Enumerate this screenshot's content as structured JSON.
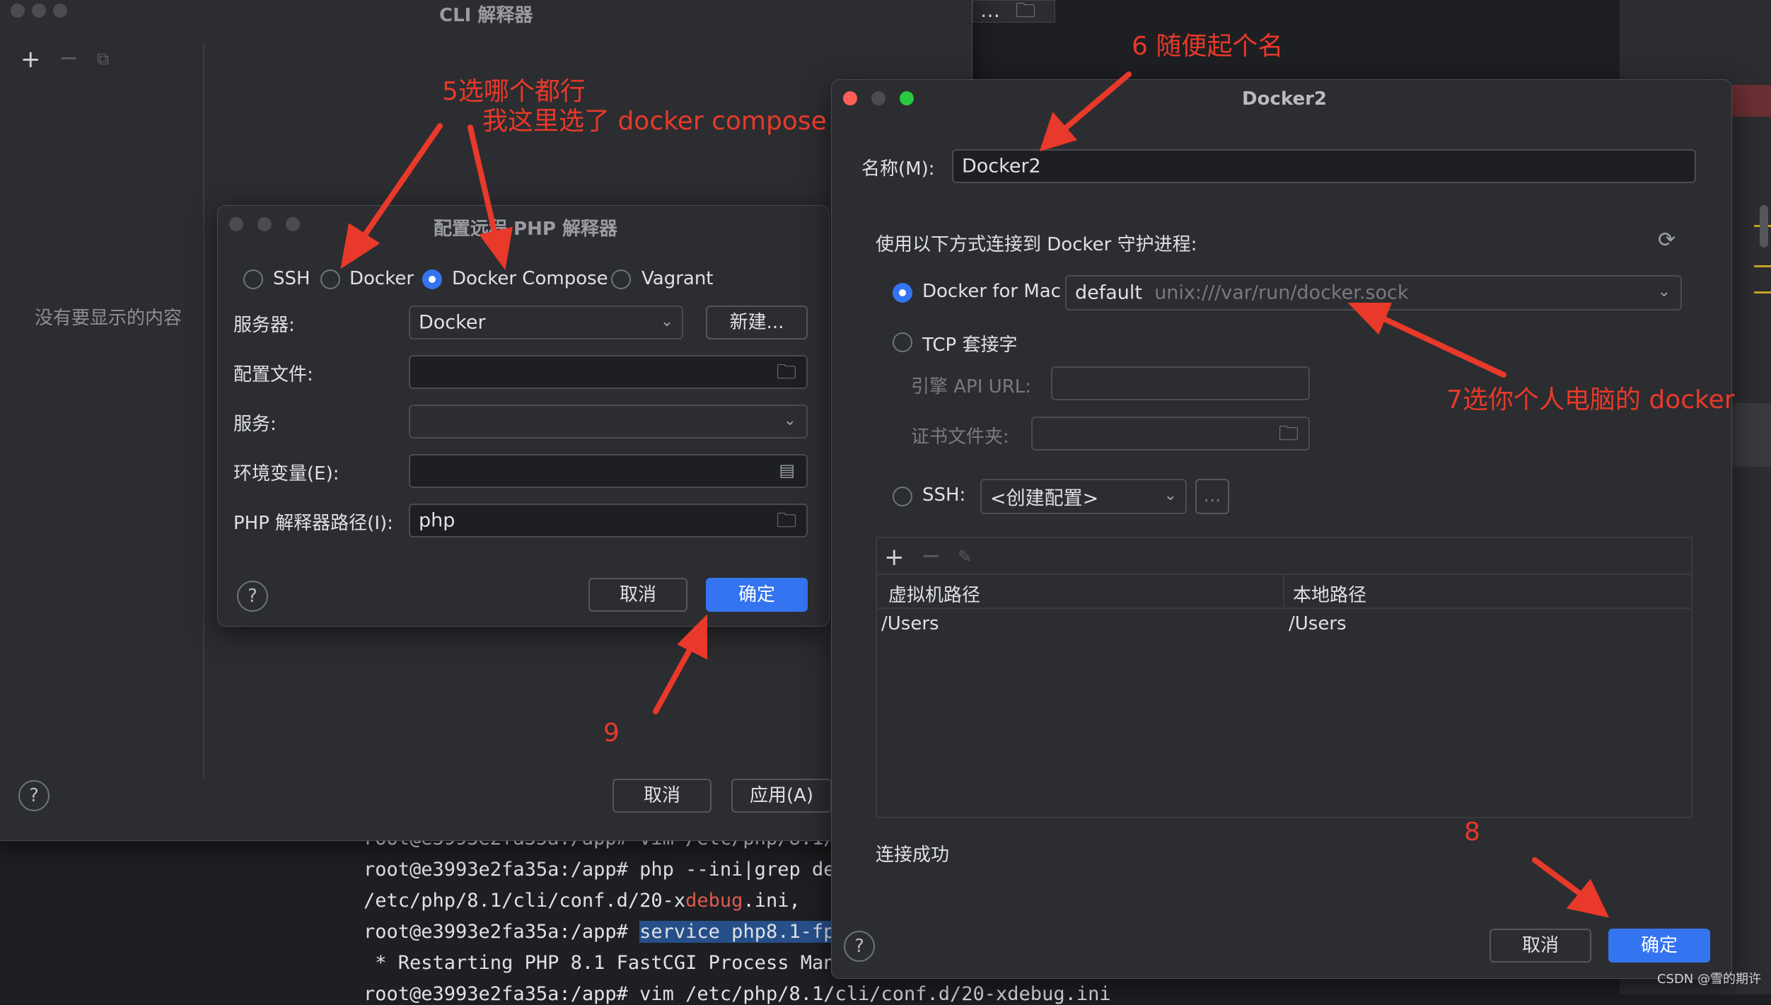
{
  "cli_window": {
    "title": "CLI 解释器",
    "empty_text": "没有要显示的内容",
    "cancel": "取消",
    "apply": "应用(A)",
    "help": "?"
  },
  "php_dialog": {
    "title": "配置远程 PHP 解释器",
    "connection_options": [
      "SSH",
      "Docker",
      "Docker Compose",
      "Vagrant"
    ],
    "selected_option": "Docker Compose",
    "server_label": "服务器:",
    "server_value": "Docker",
    "new_button": "新建...",
    "config_file_label": "配置文件:",
    "service_label": "服务:",
    "env_label": "环境变量(E):",
    "php_path_label": "PHP 解释器路径(I):",
    "php_path_value": "php",
    "cancel": "取消",
    "ok": "确定",
    "help": "?"
  },
  "docker_dialog": {
    "title": "Docker2",
    "name_label": "名称(M):",
    "name_value": "Docker2",
    "connect_heading": "使用以下方式连接到 Docker 守护进程:",
    "docker_for_mac_label": "Docker for Mac",
    "docker_for_mac_value": "default",
    "docker_for_mac_socket": "unix:///var/run/docker.sock",
    "tcp_label": "TCP 套接字",
    "api_url_label": "引擎 API URL:",
    "cert_label": "证书文件夹:",
    "ssh_label": "SSH:",
    "ssh_value": "<创建配置>",
    "ssh_more": "...",
    "table_headers": [
      "虚拟机路径",
      "本地路径"
    ],
    "table_rows": [
      [
        "/Users",
        "/Users"
      ]
    ],
    "status": "连接成功",
    "cancel": "取消",
    "ok": "确定",
    "help": "?"
  },
  "terminal": {
    "lines": [
      "root@e3993e2fa35a:/app# vim /etc/php/8.1/",
      "root@e3993e2fa35a:/app# php --ini|grep de",
      "/etc/php/8.1/cli/conf.d/20-x",
      "root@e3993e2fa35a:/app# ",
      " * Restarting PHP 8.1 FastCGI Process Man",
      "root@e3993e2fa35a:/app# vim /etc/php/8.1/cli/conf.d/20-xdebug.ini"
    ],
    "highlight_word": "debug",
    "line3_tail": ".ini,",
    "selected_text": "service php8.1-fp"
  },
  "annotations": {
    "step5_line1": "5选哪个都行",
    "step5_line2": "我这里选了 docker compose",
    "step6": "6 随便起个名",
    "step7": "7选你个人电脑的 docker",
    "step8": "8",
    "step9": "9"
  },
  "watermark": "CSDN @雪的期许",
  "colors": {
    "accent": "#3574f0",
    "annotation": "#e8392a",
    "window_bg": "#2b2d30"
  }
}
